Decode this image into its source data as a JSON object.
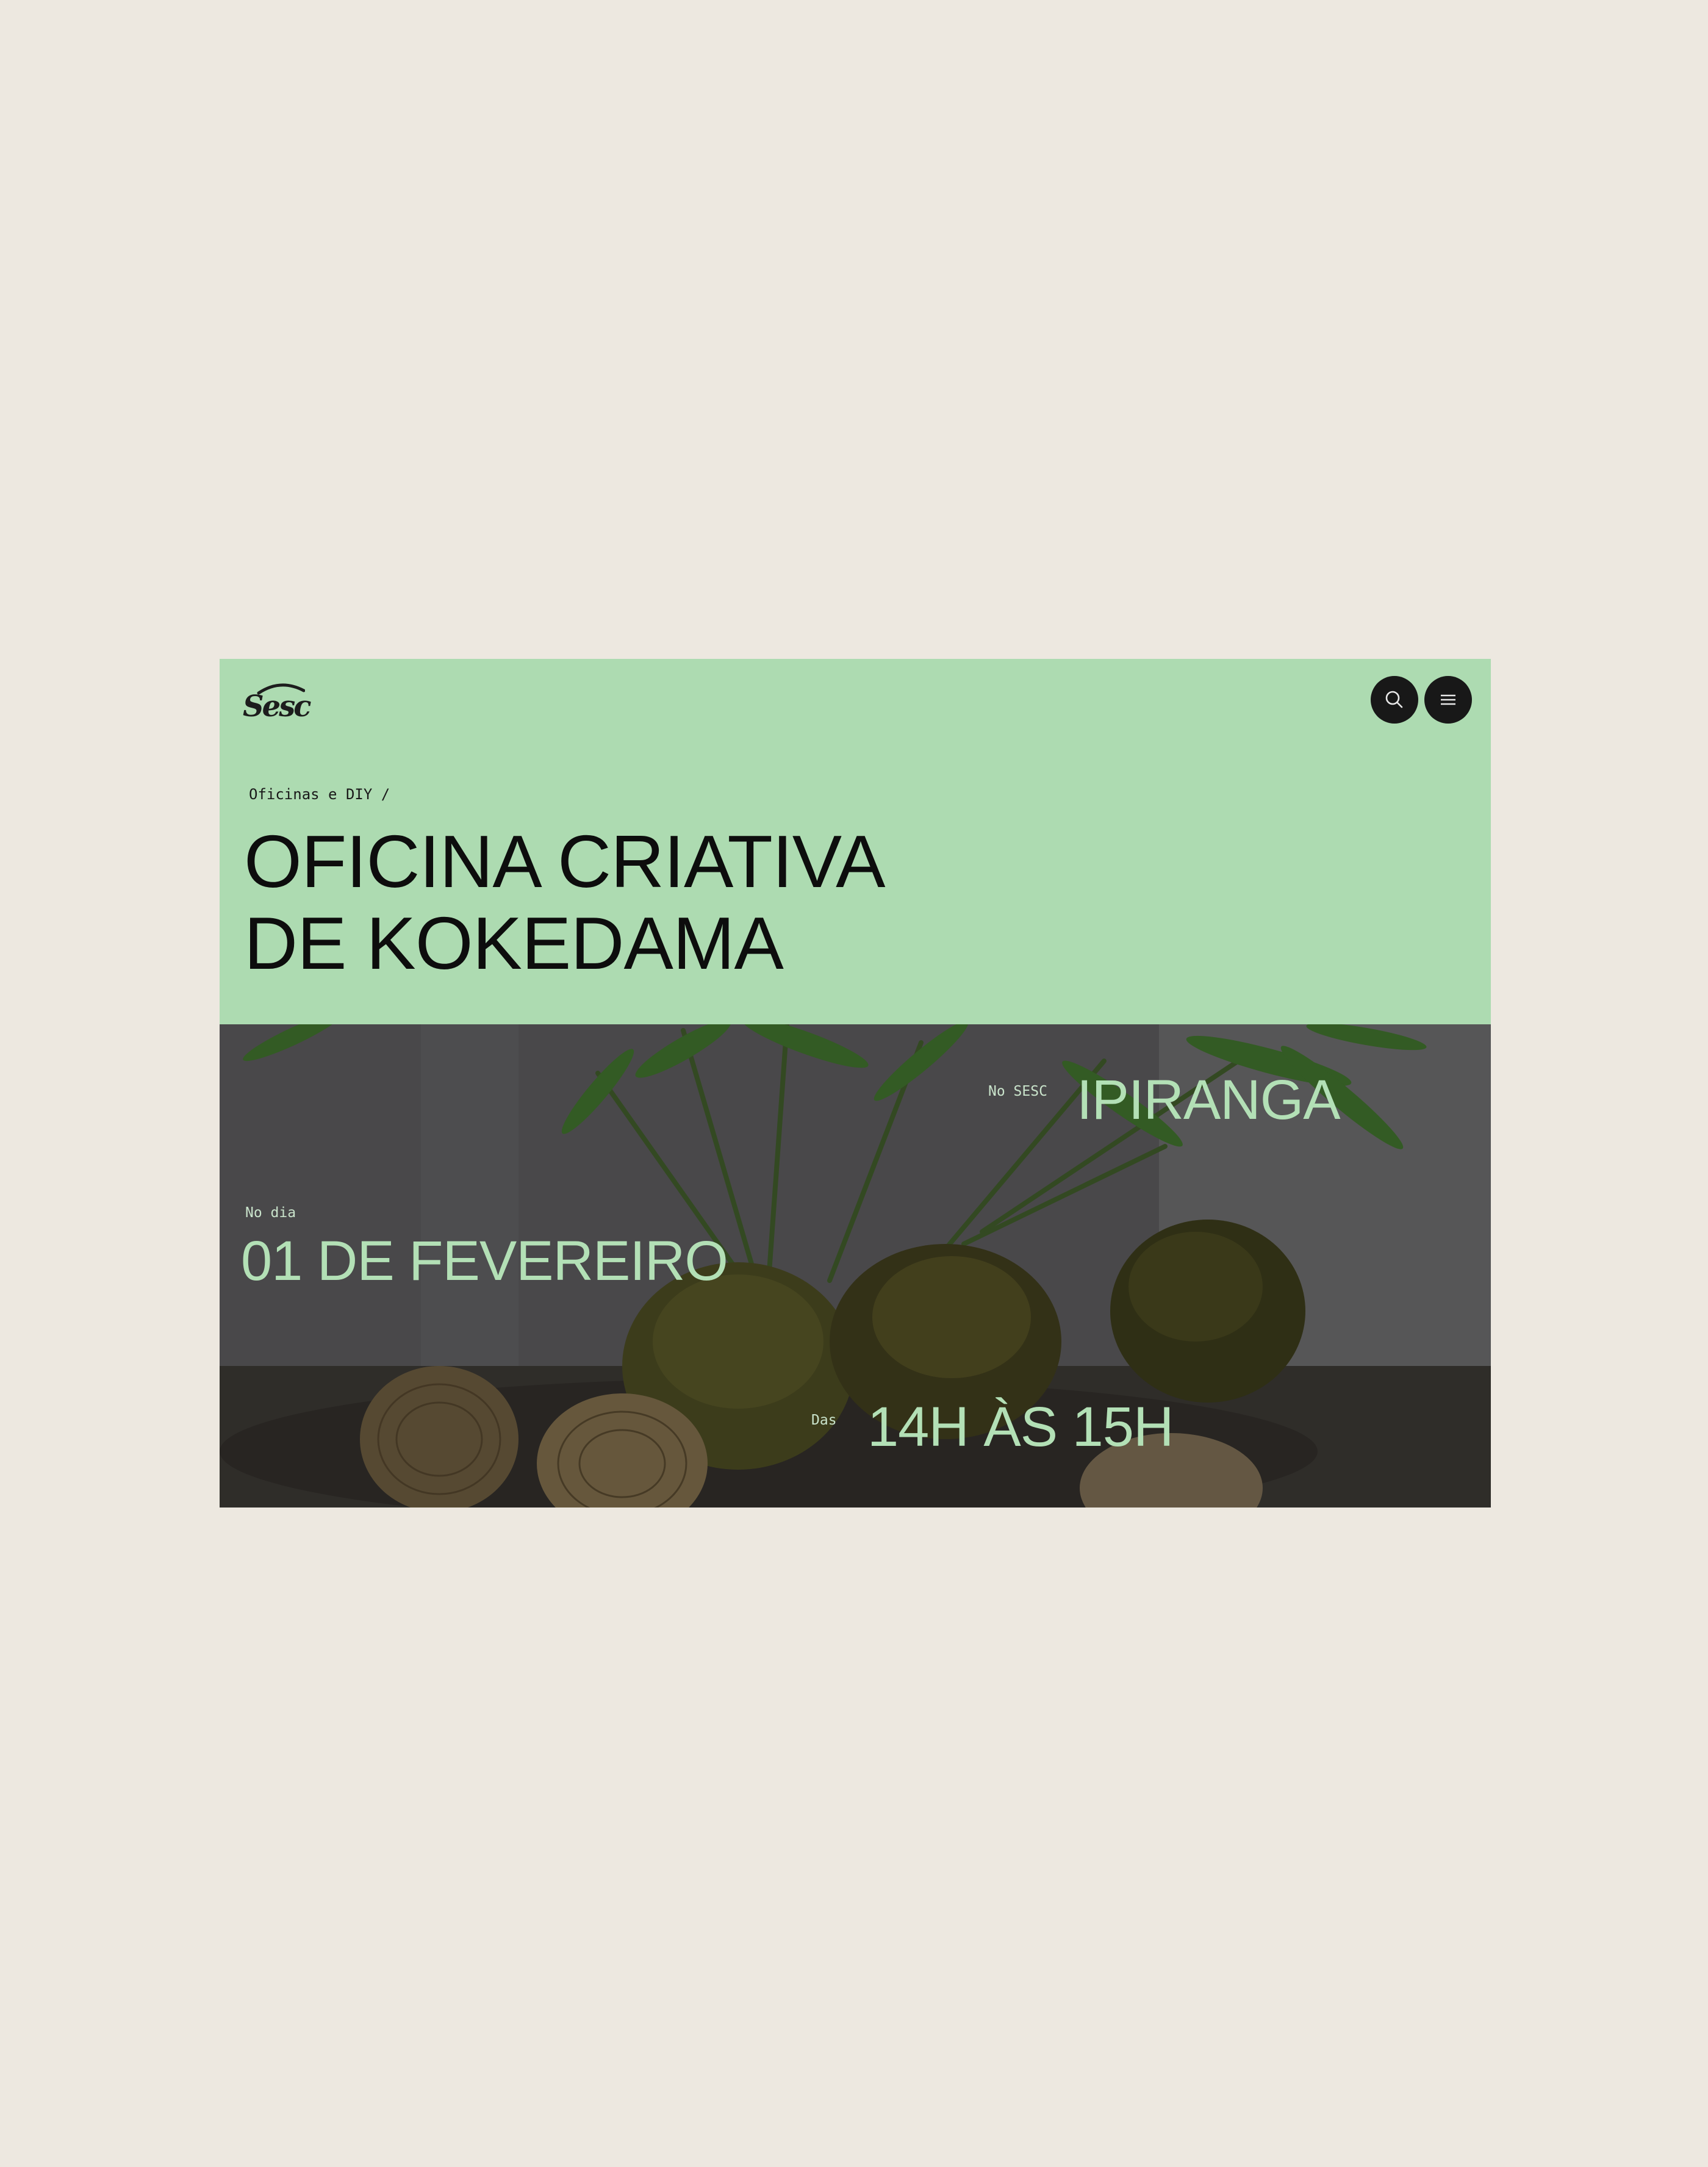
{
  "header": {
    "logo_text": "Sesc",
    "search_icon": "search-icon",
    "menu_icon": "hamburger-menu-icon"
  },
  "breadcrumb": "Oficinas e DIY /",
  "title": {
    "line1": "OFICINA CRIATIVA",
    "line2": "DE KOKEDAMA"
  },
  "event": {
    "location_label": "No SESC",
    "location": "IPIRANGA",
    "date_label": "No dia",
    "date": "01 DE FEVEREIRO",
    "time_label": "Das",
    "time": "14H ÀS 15H"
  },
  "colors": {
    "page_background": "#ede8e0",
    "accent_green": "#addbb1",
    "text_green": "#b3e0b6",
    "button_dark": "#181818"
  }
}
